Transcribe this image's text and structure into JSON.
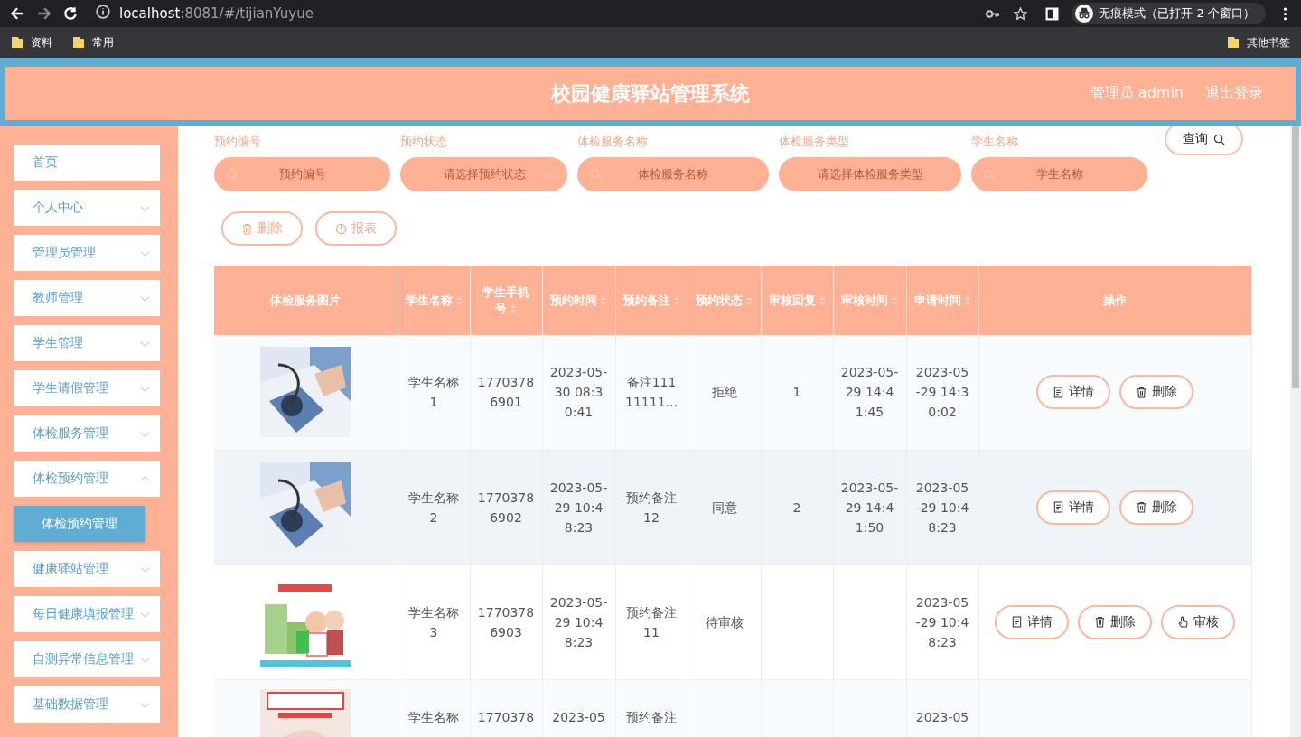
{
  "browser": {
    "url_host": "localhost",
    "url_path": ":8081/#/tijianYuyue",
    "incognito": "无痕模式（已打开 2 个窗口）",
    "bookmarks": [
      "资料",
      "常用"
    ],
    "other_bookmarks": "其他书签"
  },
  "header": {
    "title": "校园健康驿站管理系统",
    "user": "管理员 admin",
    "logout": "退出登录"
  },
  "sidebar": {
    "items": [
      {
        "label": "首页",
        "kind": "link"
      },
      {
        "label": "个人中心",
        "kind": "menu",
        "expanded": false
      },
      {
        "label": "管理员管理",
        "kind": "menu",
        "expanded": false
      },
      {
        "label": "教师管理",
        "kind": "menu",
        "expanded": false
      },
      {
        "label": "学生管理",
        "kind": "menu",
        "expanded": false
      },
      {
        "label": "学生请假管理",
        "kind": "menu",
        "expanded": false
      },
      {
        "label": "体检服务管理",
        "kind": "menu",
        "expanded": false
      },
      {
        "label": "体检预约管理",
        "kind": "menu",
        "expanded": true,
        "children": [
          {
            "label": "体检预约管理",
            "selected": true
          }
        ]
      },
      {
        "label": "健康驿站管理",
        "kind": "menu",
        "expanded": false
      },
      {
        "label": "每日健康填报管理",
        "kind": "menu",
        "expanded": false
      },
      {
        "label": "自测异常信息管理",
        "kind": "menu",
        "expanded": false
      },
      {
        "label": "基础数据管理",
        "kind": "menu",
        "expanded": false
      }
    ]
  },
  "search": {
    "fields": [
      {
        "label": "预约编号",
        "placeholder": "预约编号",
        "kind": "input"
      },
      {
        "label": "预约状态",
        "placeholder": "请选择预约状态",
        "kind": "select"
      },
      {
        "label": "体检服务名称",
        "placeholder": "体检服务名称",
        "kind": "input"
      },
      {
        "label": "体检服务类型",
        "placeholder": "请选择体检服务类型",
        "kind": "select"
      },
      {
        "label": "学生名称",
        "placeholder": "学生名称",
        "kind": "input"
      }
    ],
    "query_button": "查询"
  },
  "toolbar": [
    {
      "label": "删除",
      "kind": "delete"
    },
    {
      "label": "报表",
      "kind": "report"
    }
  ],
  "table": {
    "columns": [
      "体检服务图片",
      "学生名称",
      "学生手机号",
      "预约时间",
      "预约备注",
      "预约状态",
      "审核回复",
      "审核时间",
      "申请时间",
      "操作"
    ],
    "rows": [
      {
        "cells": [
          {
            "kind": "picture"
          },
          "学生名称1",
          "17703786901",
          "2023-05-30 08:30:41",
          "备注11111111...",
          "拒绝",
          "1",
          "2023-05-29 14:41:45",
          "2023-05-29 14:30:02"
        ],
        "actions": [
          {
            "label": "详情",
            "kind": "detail"
          },
          {
            "label": "删除",
            "kind": "delete"
          }
        ]
      },
      {
        "cells": [
          {
            "kind": "picture"
          },
          "学生名称2",
          "17703786902",
          "2023-05-29 10:48:23",
          "预约备注12",
          "同意",
          "2",
          "2023-05-29 14:41:50",
          "2023-05-29 10:48:23"
        ],
        "actions": [
          {
            "label": "详情",
            "kind": "detail"
          },
          {
            "label": "删除",
            "kind": "delete"
          }
        ]
      },
      {
        "cells": [
          {
            "kind": "picture"
          },
          "学生名称3",
          "17703786903",
          "2023-05-29 10:48:23",
          "预约备注11",
          "待审核",
          "",
          "",
          "2023-05-29 10:48:23"
        ],
        "actions": [
          {
            "label": "详情",
            "kind": "detail"
          },
          {
            "label": "删除",
            "kind": "delete"
          },
          {
            "label": "审核",
            "kind": "audit"
          }
        ]
      },
      {
        "cells": [
          {
            "kind": "picture"
          },
          "学生名称",
          "1770378",
          "2023-05",
          "预约备注",
          "",
          "",
          "",
          "2023-05"
        ]
      }
    ]
  }
}
